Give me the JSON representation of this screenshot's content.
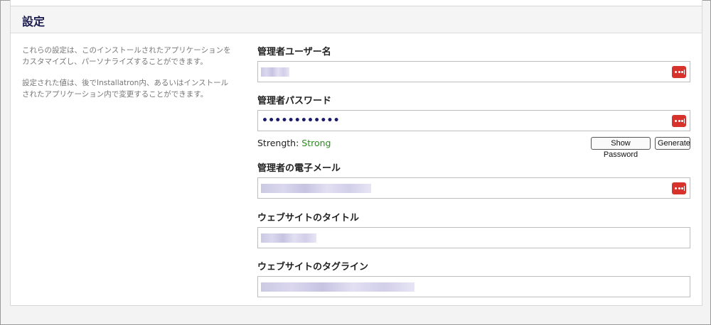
{
  "section": {
    "title": "設定",
    "description_1": "これらの設定は、このインストールされたアプリケーションをカスタマイズし、パーソナライズすることができます。",
    "description_2": "設定された値は、後でInstallatron内、あるいはインストールされたアプリケーション内で変更することができます。"
  },
  "fields": {
    "admin_username": {
      "label": "管理者ユーザー名"
    },
    "admin_password": {
      "label": "管理者パスワード",
      "value": "••••••••••••"
    },
    "admin_email": {
      "label": "管理者の電子メール"
    },
    "site_title": {
      "label": "ウェブサイトのタイトル"
    },
    "site_tagline": {
      "label": "ウェブサイトのタグライン"
    }
  },
  "password_strength": {
    "label": "Strength:",
    "value": "Strong",
    "color": "#2b8a1e"
  },
  "buttons": {
    "show_password": "Show Password",
    "generate": "Generate"
  },
  "icons": {
    "password_manager": "password-manager-icon"
  },
  "colors": {
    "password_manager_icon": "#d7322b",
    "title": "#1b1b4f"
  }
}
